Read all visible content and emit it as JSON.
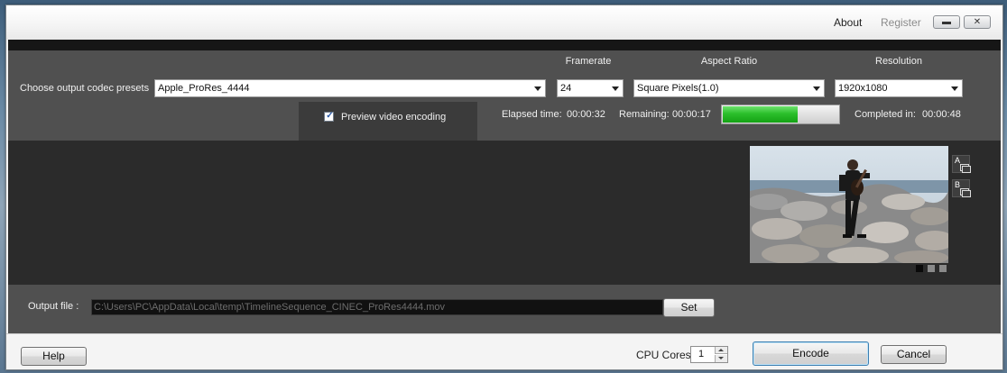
{
  "topbar": {
    "about": "About",
    "register": "Register"
  },
  "codec": {
    "label": "Choose output codec presets",
    "selected": "Apple_ProRes_4444"
  },
  "framerate": {
    "header": "Framerate",
    "selected": "24"
  },
  "aspect_ratio": {
    "header": "Aspect Ratio",
    "selected": "Square Pixels(1.0)"
  },
  "resolution": {
    "header": "Resolution",
    "selected": "1920x1080"
  },
  "preview": {
    "label": "Preview video encoding",
    "checked": true,
    "compare_a": "A",
    "compare_b": "B"
  },
  "progress": {
    "elapsed_label": "Elapsed time:",
    "elapsed_value": "00:00:32",
    "remaining_label": "Remaining:",
    "remaining_value": "00:00:17",
    "completed_label": "Completed in:",
    "completed_value": "00:00:48",
    "fraction": 0.65,
    "color": "#2bbf2b"
  },
  "output": {
    "label": "Output file :",
    "path": "C:\\Users\\PC\\AppData\\Local\\temp\\TimelineSequence_CINEC_ProRes4444.mov",
    "set_button": "Set"
  },
  "footer": {
    "help": "Help",
    "cpu_label": "CPU Cores",
    "cpu_value": "1",
    "encode": "Encode",
    "cancel": "Cancel"
  },
  "icons": {
    "minimize": "minimize-icon",
    "close": "close-icon",
    "dropdown": "chevron-down-icon"
  }
}
